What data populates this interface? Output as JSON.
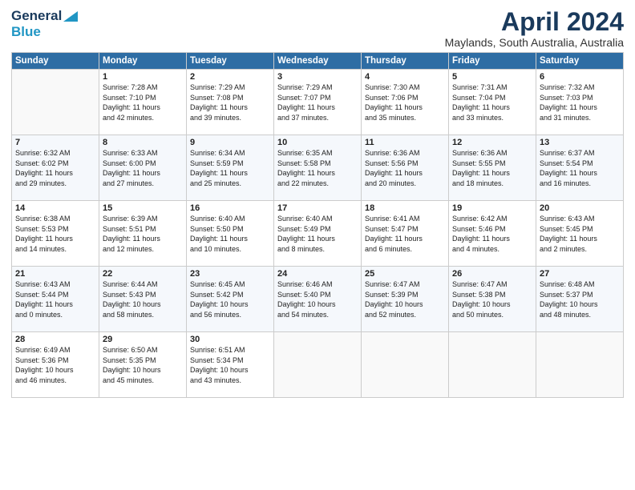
{
  "header": {
    "logo_line1": "General",
    "logo_line2": "Blue",
    "month": "April 2024",
    "location": "Maylands, South Australia, Australia"
  },
  "days_of_week": [
    "Sunday",
    "Monday",
    "Tuesday",
    "Wednesday",
    "Thursday",
    "Friday",
    "Saturday"
  ],
  "weeks": [
    [
      {
        "day": "",
        "content": ""
      },
      {
        "day": "1",
        "content": "Sunrise: 7:28 AM\nSunset: 7:10 PM\nDaylight: 11 hours\nand 42 minutes."
      },
      {
        "day": "2",
        "content": "Sunrise: 7:29 AM\nSunset: 7:08 PM\nDaylight: 11 hours\nand 39 minutes."
      },
      {
        "day": "3",
        "content": "Sunrise: 7:29 AM\nSunset: 7:07 PM\nDaylight: 11 hours\nand 37 minutes."
      },
      {
        "day": "4",
        "content": "Sunrise: 7:30 AM\nSunset: 7:06 PM\nDaylight: 11 hours\nand 35 minutes."
      },
      {
        "day": "5",
        "content": "Sunrise: 7:31 AM\nSunset: 7:04 PM\nDaylight: 11 hours\nand 33 minutes."
      },
      {
        "day": "6",
        "content": "Sunrise: 7:32 AM\nSunset: 7:03 PM\nDaylight: 11 hours\nand 31 minutes."
      }
    ],
    [
      {
        "day": "7",
        "content": "Sunrise: 6:32 AM\nSunset: 6:02 PM\nDaylight: 11 hours\nand 29 minutes."
      },
      {
        "day": "8",
        "content": "Sunrise: 6:33 AM\nSunset: 6:00 PM\nDaylight: 11 hours\nand 27 minutes."
      },
      {
        "day": "9",
        "content": "Sunrise: 6:34 AM\nSunset: 5:59 PM\nDaylight: 11 hours\nand 25 minutes."
      },
      {
        "day": "10",
        "content": "Sunrise: 6:35 AM\nSunset: 5:58 PM\nDaylight: 11 hours\nand 22 minutes."
      },
      {
        "day": "11",
        "content": "Sunrise: 6:36 AM\nSunset: 5:56 PM\nDaylight: 11 hours\nand 20 minutes."
      },
      {
        "day": "12",
        "content": "Sunrise: 6:36 AM\nSunset: 5:55 PM\nDaylight: 11 hours\nand 18 minutes."
      },
      {
        "day": "13",
        "content": "Sunrise: 6:37 AM\nSunset: 5:54 PM\nDaylight: 11 hours\nand 16 minutes."
      }
    ],
    [
      {
        "day": "14",
        "content": "Sunrise: 6:38 AM\nSunset: 5:53 PM\nDaylight: 11 hours\nand 14 minutes."
      },
      {
        "day": "15",
        "content": "Sunrise: 6:39 AM\nSunset: 5:51 PM\nDaylight: 11 hours\nand 12 minutes."
      },
      {
        "day": "16",
        "content": "Sunrise: 6:40 AM\nSunset: 5:50 PM\nDaylight: 11 hours\nand 10 minutes."
      },
      {
        "day": "17",
        "content": "Sunrise: 6:40 AM\nSunset: 5:49 PM\nDaylight: 11 hours\nand 8 minutes."
      },
      {
        "day": "18",
        "content": "Sunrise: 6:41 AM\nSunset: 5:47 PM\nDaylight: 11 hours\nand 6 minutes."
      },
      {
        "day": "19",
        "content": "Sunrise: 6:42 AM\nSunset: 5:46 PM\nDaylight: 11 hours\nand 4 minutes."
      },
      {
        "day": "20",
        "content": "Sunrise: 6:43 AM\nSunset: 5:45 PM\nDaylight: 11 hours\nand 2 minutes."
      }
    ],
    [
      {
        "day": "21",
        "content": "Sunrise: 6:43 AM\nSunset: 5:44 PM\nDaylight: 11 hours\nand 0 minutes."
      },
      {
        "day": "22",
        "content": "Sunrise: 6:44 AM\nSunset: 5:43 PM\nDaylight: 10 hours\nand 58 minutes."
      },
      {
        "day": "23",
        "content": "Sunrise: 6:45 AM\nSunset: 5:42 PM\nDaylight: 10 hours\nand 56 minutes."
      },
      {
        "day": "24",
        "content": "Sunrise: 6:46 AM\nSunset: 5:40 PM\nDaylight: 10 hours\nand 54 minutes."
      },
      {
        "day": "25",
        "content": "Sunrise: 6:47 AM\nSunset: 5:39 PM\nDaylight: 10 hours\nand 52 minutes."
      },
      {
        "day": "26",
        "content": "Sunrise: 6:47 AM\nSunset: 5:38 PM\nDaylight: 10 hours\nand 50 minutes."
      },
      {
        "day": "27",
        "content": "Sunrise: 6:48 AM\nSunset: 5:37 PM\nDaylight: 10 hours\nand 48 minutes."
      }
    ],
    [
      {
        "day": "28",
        "content": "Sunrise: 6:49 AM\nSunset: 5:36 PM\nDaylight: 10 hours\nand 46 minutes."
      },
      {
        "day": "29",
        "content": "Sunrise: 6:50 AM\nSunset: 5:35 PM\nDaylight: 10 hours\nand 45 minutes."
      },
      {
        "day": "30",
        "content": "Sunrise: 6:51 AM\nSunset: 5:34 PM\nDaylight: 10 hours\nand 43 minutes."
      },
      {
        "day": "",
        "content": ""
      },
      {
        "day": "",
        "content": ""
      },
      {
        "day": "",
        "content": ""
      },
      {
        "day": "",
        "content": ""
      }
    ]
  ]
}
